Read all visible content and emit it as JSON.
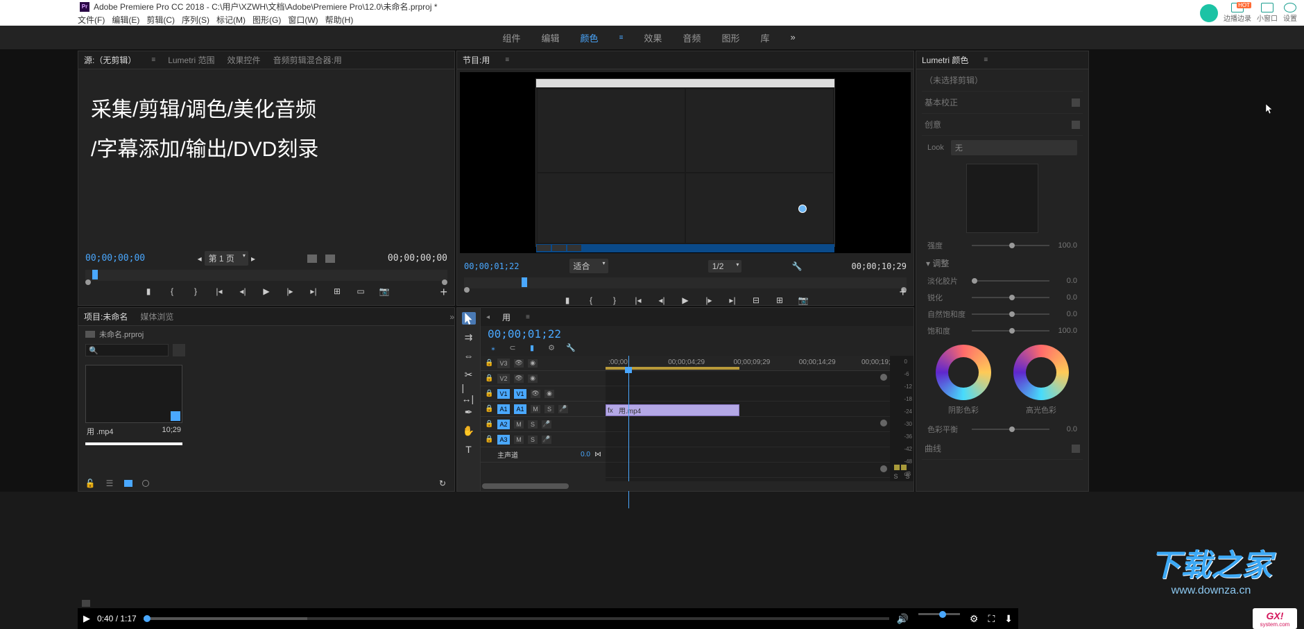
{
  "app": {
    "title": "Adobe Premiere Pro CC 2018 - C:\\用户\\XZWH\\文档\\Adobe\\Premiere Pro\\12.0\\未命名.prproj *",
    "icon_label": "Pr"
  },
  "menus": [
    "文件(F)",
    "编辑(E)",
    "剪辑(C)",
    "序列(S)",
    "标记(M)",
    "图形(G)",
    "窗口(W)",
    "帮助(H)"
  ],
  "ext_buttons": {
    "rec": "边播边录",
    "hot": "HOT",
    "mini": "小窗口",
    "set": "设置"
  },
  "workspaces": [
    "组件",
    "编辑",
    "颜色",
    "效果",
    "音频",
    "图形",
    "库"
  ],
  "active_workspace": "颜色",
  "source": {
    "tabs": [
      "源:（无剪辑）",
      "Lumetri 范围",
      "效果控件",
      "音频剪辑混合器:用"
    ],
    "active_tab": 0,
    "overlay_line1": "采集/剪辑/调色/美化音频",
    "overlay_line2": "/字幕添加/输出/DVD刻录",
    "tc_in": "00;00;00;00",
    "page_label": "第 1 页",
    "tc_out": "00;00;00;00"
  },
  "program": {
    "tab": "节目:用",
    "tc_cur": "00;00;01;22",
    "fit": "适合",
    "zoom": "1/2",
    "tc_dur": "00;00;10;29"
  },
  "lumetri": {
    "tab": "Lumetri 颜色",
    "no_sel": "（未选择剪辑）",
    "basic": "基本校正",
    "creative": "创意",
    "look_lbl": "Look",
    "look_val": "无",
    "intensity": {
      "lbl": "强度",
      "val": "100.0"
    },
    "adjust": "调整",
    "sliders": [
      {
        "lbl": "淡化胶片",
        "val": "0.0"
      },
      {
        "lbl": "锐化",
        "val": "0.0"
      },
      {
        "lbl": "自然饱和度",
        "val": "0.0"
      },
      {
        "lbl": "饱和度",
        "val": "100.0"
      }
    ],
    "wheel_shadow": "阴影色彩",
    "wheel_high": "高光色彩",
    "balance": {
      "lbl": "色彩平衡",
      "val": "0.0"
    },
    "curves": "曲线"
  },
  "project": {
    "tabs": [
      "项目:未命名",
      "媒体浏览"
    ],
    "file": "未命名.prproj",
    "clip_name": "用 .mp4",
    "clip_dur": "10;29"
  },
  "timeline": {
    "seq_name": "用",
    "tc": "00;00;01;22",
    "ticks": [
      ":00;00",
      "00;00;04;29",
      "00;00;09;29",
      "00;00;14;29",
      "00;00;19;29"
    ],
    "video_tracks": [
      "V3",
      "V2",
      "V1"
    ],
    "audio_tracks": [
      "A1",
      "A2",
      "A3"
    ],
    "master": "主声道",
    "master_val": "0.0",
    "clip_label": "用.mp4",
    "meter_marks": [
      "0",
      "-6",
      "-12",
      "-18",
      "-24",
      "-30",
      "-36",
      "-42",
      "-48",
      "dB"
    ],
    "solo_l": "S",
    "solo_r": "S",
    "mute": "M",
    "solo": "S"
  },
  "player": {
    "cur": "0:40",
    "dur": "1:17"
  },
  "watermark": {
    "txt": "下载之家",
    "sub": "www.downza.cn",
    "gx": "GX!",
    "gxsub": "system.com"
  }
}
